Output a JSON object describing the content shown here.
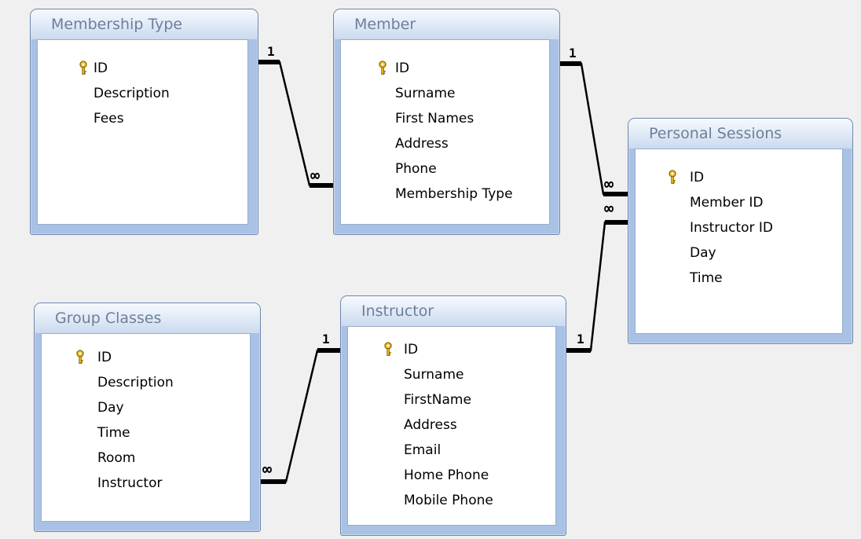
{
  "tables": {
    "membership_type": {
      "title": "Membership Type",
      "fields": [
        "ID",
        "Description",
        "Fees"
      ]
    },
    "member": {
      "title": "Member",
      "fields": [
        "ID",
        "Surname",
        "First Names",
        "Address",
        "Phone",
        "Membership Type"
      ]
    },
    "personal_sessions": {
      "title": "Personal Sessions",
      "fields": [
        "ID",
        "Member ID",
        "Instructor ID",
        "Day",
        "Time"
      ]
    },
    "group_classes": {
      "title": "Group Classes",
      "fields": [
        "ID",
        "Description",
        "Day",
        "Time",
        "Room",
        "Instructor"
      ]
    },
    "instructor": {
      "title": "Instructor",
      "fields": [
        "ID",
        "Surname",
        "FirstName",
        "Address",
        "Email",
        "Home Phone",
        "Mobile Phone"
      ]
    }
  },
  "relationships": {
    "one_label": "1",
    "many_label": "∞"
  },
  "icons": {
    "primary_key": "key-icon"
  },
  "colors": {
    "window_frame": "#a9c1e4",
    "title_text": "#6d7f99",
    "relationship_line": "#000000"
  }
}
